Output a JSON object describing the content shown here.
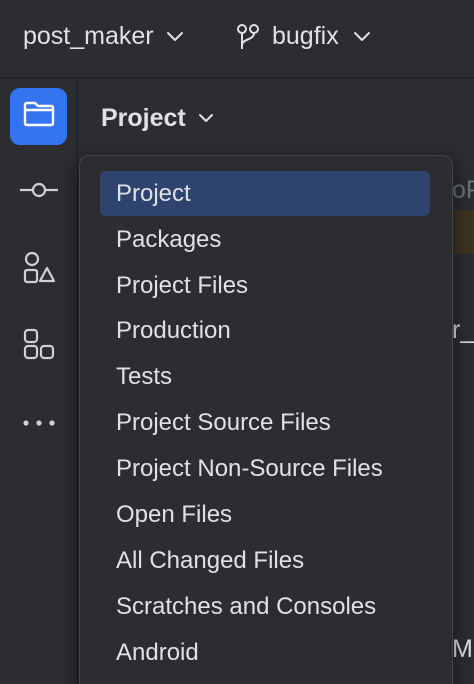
{
  "toolbar": {
    "project_name": "post_maker",
    "branch_name": "bugfix"
  },
  "toolstrip": {
    "items": [
      {
        "icon": "folder-icon",
        "active": true
      },
      {
        "icon": "commit-icon",
        "active": false
      },
      {
        "icon": "shapes-icon",
        "active": false
      },
      {
        "icon": "structure-icon",
        "active": false
      },
      {
        "icon": "more-icon",
        "active": false
      }
    ]
  },
  "panel": {
    "title": "Project",
    "peek_texts": [
      "oP",
      "r_",
      "M"
    ]
  },
  "view_menu": {
    "selected": "Project",
    "items": [
      "Project",
      "Packages",
      "Project Files",
      "Production",
      "Tests",
      "Project Source Files",
      "Project Non-Source Files",
      "Open Files",
      "All Changed Files",
      "Scratches and Consoles",
      "Android"
    ]
  },
  "colors": {
    "accent": "#3574f0",
    "selection": "#2e436e",
    "background": "#2b2d30",
    "text": "#dfe1e5"
  }
}
